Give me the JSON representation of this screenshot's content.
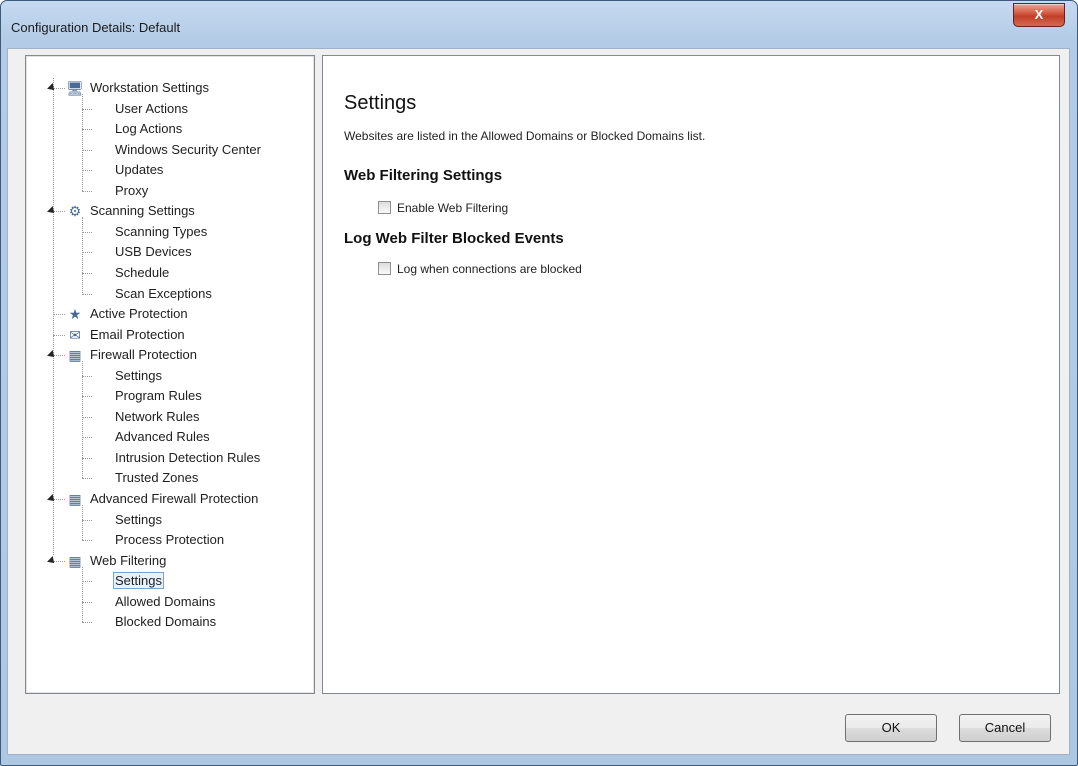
{
  "window": {
    "title": "Configuration Details: Default",
    "close_label": "X"
  },
  "tree": {
    "items": [
      {
        "label": "Workstation Settings",
        "icon": "workstation-icon",
        "expanded": true
      },
      {
        "label": "User Actions"
      },
      {
        "label": "Log Actions"
      },
      {
        "label": "Windows Security Center"
      },
      {
        "label": "Updates"
      },
      {
        "label": "Proxy"
      },
      {
        "label": "Scanning Settings",
        "icon": "scanning-icon",
        "expanded": true
      },
      {
        "label": "Scanning Types"
      },
      {
        "label": "USB Devices"
      },
      {
        "label": "Schedule"
      },
      {
        "label": "Scan Exceptions"
      },
      {
        "label": "Active Protection",
        "icon": "active-protection-icon"
      },
      {
        "label": "Email Protection",
        "icon": "email-icon"
      },
      {
        "label": "Firewall Protection",
        "icon": "firewall-icon",
        "expanded": true
      },
      {
        "label": "Settings"
      },
      {
        "label": "Program Rules"
      },
      {
        "label": "Network Rules"
      },
      {
        "label": "Advanced Rules"
      },
      {
        "label": "Intrusion Detection Rules"
      },
      {
        "label": "Trusted Zones"
      },
      {
        "label": "Advanced Firewall Protection",
        "icon": "firewall-icon",
        "expanded": true
      },
      {
        "label": "Settings"
      },
      {
        "label": "Process Protection"
      },
      {
        "label": "Web Filtering",
        "icon": "firewall-icon",
        "expanded": true
      },
      {
        "label": "Settings",
        "selected": true
      },
      {
        "label": "Allowed Domains"
      },
      {
        "label": "Blocked Domains"
      }
    ]
  },
  "content": {
    "title": "Settings",
    "description": "Websites are listed in the Allowed Domains or Blocked Domains list.",
    "sections": [
      {
        "heading": "Web Filtering Settings",
        "checkbox_label": "Enable Web Filtering",
        "checked": false
      },
      {
        "heading": "Log Web Filter Blocked Events",
        "checkbox_label": "Log when connections are blocked",
        "checked": false
      }
    ]
  },
  "buttons": {
    "ok": "OK",
    "cancel": "Cancel"
  },
  "colors": {
    "window_frame": "#b3cbe6",
    "close_button": "#c7462f",
    "selection_border": "#7da2ce"
  }
}
